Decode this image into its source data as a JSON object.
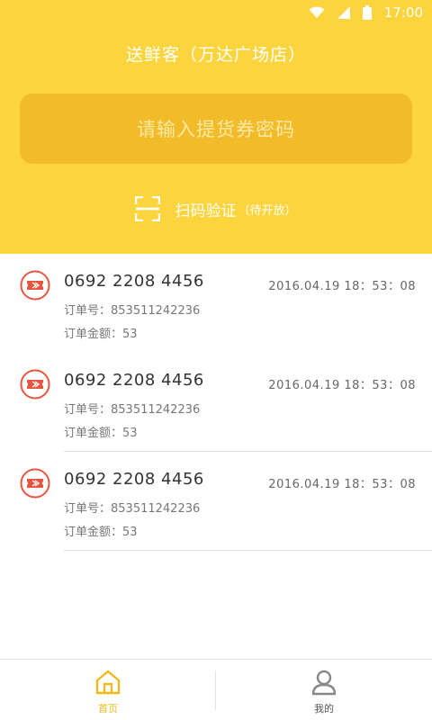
{
  "status_bar": {
    "time": "17:00",
    "icons": [
      "wifi-icon",
      "signal-icon",
      "battery-icon"
    ]
  },
  "header": {
    "title": "送鲜客（万达广场店）",
    "code_input_placeholder": "请输入提货券密码",
    "scan_label": "扫码验证",
    "scan_sub": "（待开放）"
  },
  "orders": [
    {
      "code": "0692  2208  4456",
      "datetime": "2016.04.19   18：53：08",
      "order_no": "订单号：853511242236",
      "amount": "订单金额：53"
    },
    {
      "code": "0692  2208  4456",
      "datetime": "2016.04.19   18：53：08",
      "order_no": "订单号：853511242236",
      "amount": "订单金额：53"
    },
    {
      "code": "0692  2208  4456",
      "datetime": "2016.04.19   18：53：08",
      "order_no": "订单号：853511242236",
      "amount": "订单金额：53"
    }
  ],
  "bottom_nav": {
    "home_label": "首页",
    "mine_label": "我的"
  },
  "colors": {
    "header_bg": "#fbd43e",
    "input_bg": "#f2bb29",
    "accent": "#f0b91e",
    "ticket_red": "#e8553f",
    "nav_inactive": "#888888"
  }
}
